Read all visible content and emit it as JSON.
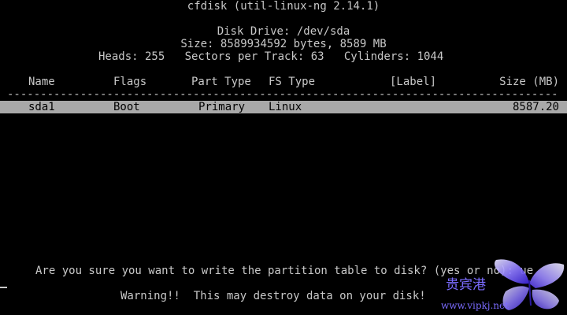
{
  "app": {
    "title": "cfdisk (util-linux-ng 2.14.1)"
  },
  "disk": {
    "drive_line": "Disk Drive: /dev/sda",
    "size_line": "Size: 8589934592 bytes, 8589 MB",
    "geometry_line": "Heads: 255   Sectors per Track: 63   Cylinders: 1044"
  },
  "table": {
    "headers": {
      "name": "Name",
      "flags": "Flags",
      "part_type": "Part Type",
      "fs_type": "FS Type",
      "label": "[Label]",
      "size": "Size (MB)"
    },
    "separator": "---------------------------------------------------------------------------------------",
    "rows": [
      {
        "name": "sda1",
        "flags": "Boot",
        "part_type": "Primary",
        "fs_type": "Linux",
        "label": "",
        "size": "8587.20"
      }
    ]
  },
  "prompt": {
    "question": "Are you sure you want to write the partition table to disk? (yes or no): ue",
    "warning": "Warning!!  This may destroy data on your disk!"
  },
  "watermark": {
    "cn_text": "贵宾港",
    "url": "www.vipkj.net",
    "colors": {
      "wing_light": "#e8e4ff",
      "wing_mid": "#8f7cff",
      "wing_dark": "#3a22d8",
      "text": "#7b6cff"
    }
  },
  "colors": {
    "background": "#000000",
    "foreground": "#c8c8c8",
    "highlight_bg": "#a8a8a8",
    "highlight_fg": "#000000"
  }
}
